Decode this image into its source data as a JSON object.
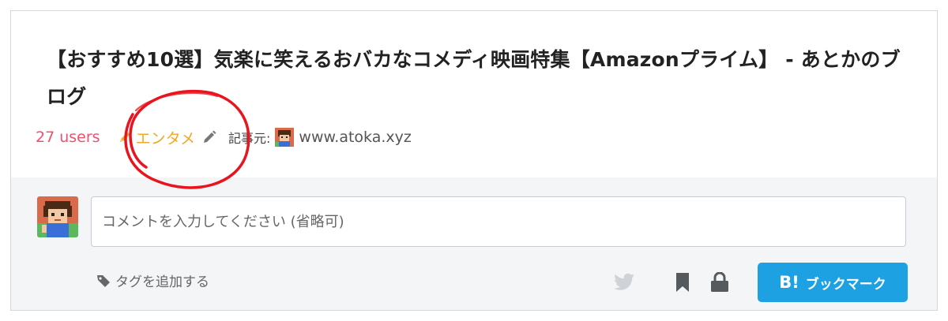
{
  "entry": {
    "title": "【おすすめ10選】気楽に笑えるおバカなコメディ映画特集【Amazonプライム】 - あとかのブログ",
    "users": "27 users",
    "category": "エンタメ",
    "source_label": "記事元:",
    "site": "www.atoka.xyz"
  },
  "comment": {
    "placeholder": "コメントを入力してください (省略可)"
  },
  "actions": {
    "add_tag": "タグを追加する",
    "bookmark_b": "B!",
    "bookmark_label": "ブックマーク"
  },
  "colors": {
    "users": "#f0506e",
    "category": "#f5a623",
    "bookmark_button": "#1ea1e3",
    "annotation_circle": "#e8141e",
    "footer_bg": "#f4f5f7"
  },
  "icons": [
    "pencil-icon",
    "edit-icon",
    "twitter-icon",
    "bookmark-icon",
    "lock-icon",
    "tag-icon"
  ]
}
